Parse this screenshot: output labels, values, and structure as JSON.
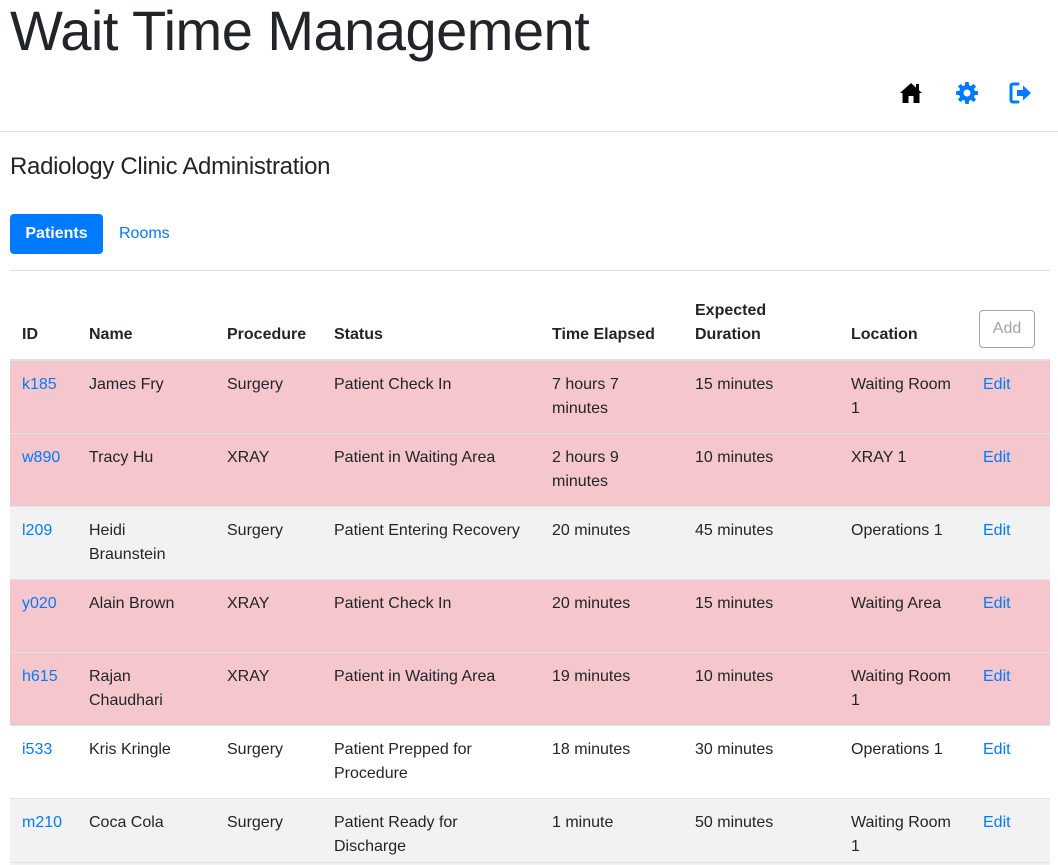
{
  "app": {
    "title": "Wait Time Management"
  },
  "header_icons": [
    {
      "name": "home-icon",
      "color": "#000000"
    },
    {
      "name": "gear-icon",
      "color": "#007bff"
    },
    {
      "name": "sign-out-icon",
      "color": "#007bff"
    }
  ],
  "page": {
    "title": "Radiology Clinic Administration"
  },
  "tabs": [
    {
      "label": "Patients",
      "active": true
    },
    {
      "label": "Rooms",
      "active": false
    }
  ],
  "table": {
    "headers": {
      "id": "ID",
      "name": "Name",
      "procedure": "Procedure",
      "status": "Status",
      "elapsed": "Time Elapsed",
      "duration_line1": "Expected",
      "duration_line2": "Duration",
      "location": "Location",
      "add_label": "Add"
    },
    "rows": [
      {
        "id": "k185",
        "name": "James Fry",
        "procedure": "Surgery",
        "status": "Patient Check In",
        "elapsed": "7 hours 7 minutes",
        "duration": "15 minutes",
        "location": "Waiting Room 1",
        "action": "Edit",
        "highlight": true
      },
      {
        "id": "w890",
        "name": "Tracy Hu",
        "procedure": "XRAY",
        "status": "Patient in Waiting Area",
        "elapsed": "2 hours 9 minutes",
        "duration": "10 minutes",
        "location": "XRAY 1",
        "action": "Edit",
        "highlight": true
      },
      {
        "id": "l209",
        "name": "Heidi Braunstein",
        "procedure": "Surgery",
        "status": "Patient Entering Recovery",
        "elapsed": "20 minutes",
        "duration": "45 minutes",
        "location": "Operations 1",
        "action": "Edit",
        "highlight": false
      },
      {
        "id": "y020",
        "name": "Alain Brown",
        "procedure": "XRAY",
        "status": "Patient Check In",
        "elapsed": "20 minutes",
        "duration": "15 minutes",
        "location": "Waiting Area",
        "action": "Edit",
        "highlight": true
      },
      {
        "id": "h615",
        "name": "Rajan Chaudhari",
        "procedure": "XRAY",
        "status": "Patient in Waiting Area",
        "elapsed": "19 minutes",
        "duration": "10 minutes",
        "location": "Waiting Room 1",
        "action": "Edit",
        "highlight": true
      },
      {
        "id": "i533",
        "name": "Kris Kringle",
        "procedure": "Surgery",
        "status": "Patient Prepped for Procedure",
        "elapsed": "18 minutes",
        "duration": "30 minutes",
        "location": "Operations 1",
        "action": "Edit",
        "highlight": false
      },
      {
        "id": "m210",
        "name": "Coca Cola",
        "procedure": "Surgery",
        "status": "Patient Ready for Discharge",
        "elapsed": "1 minute",
        "duration": "50 minutes",
        "location": "Waiting Room 1",
        "action": "Edit",
        "highlight": false
      }
    ]
  },
  "colors": {
    "primary": "#007bff",
    "alert_row": "#f5c6cb",
    "striped_row": "#f2f2f2"
  }
}
